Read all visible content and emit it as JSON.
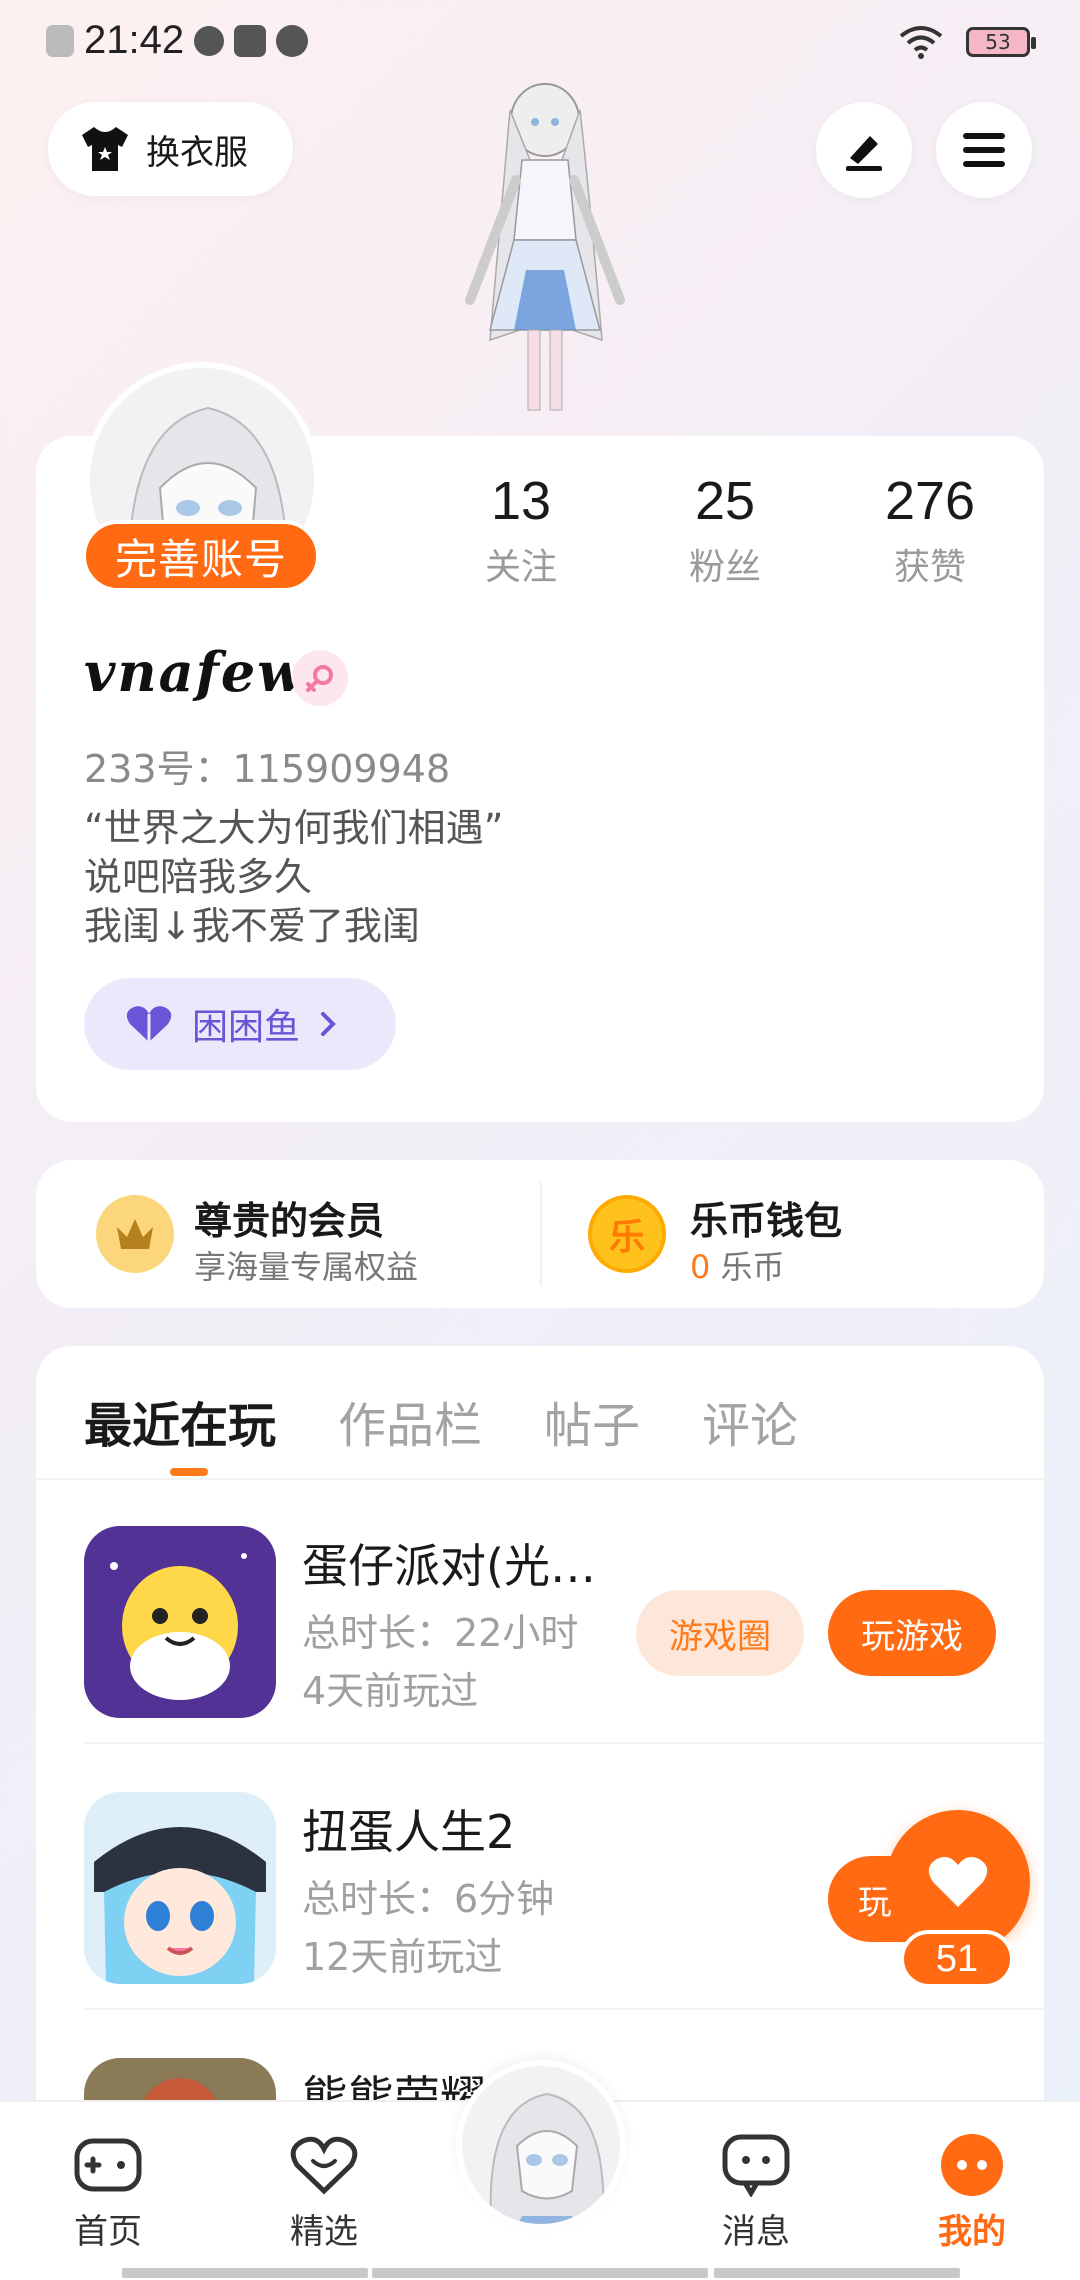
{
  "status_bar": {
    "time": "21:42",
    "battery": "53"
  },
  "header": {
    "outfit_label": "换衣服"
  },
  "profile": {
    "complete_badge": "完善账号",
    "stats": [
      {
        "num": "13",
        "label": "关注"
      },
      {
        "num": "25",
        "label": "粉丝"
      },
      {
        "num": "276",
        "label": "获赞"
      }
    ],
    "username": "vnafew",
    "uid": "233号：115909948",
    "bio": [
      "“世界之大为何我们相遇”",
      "说吧陪我多久",
      "我闺↓我不爱了我闺"
    ],
    "fish_label": "困困鱼"
  },
  "wallet": {
    "vip_title": "尊贵的会员",
    "vip_sub": "享海量专属权益",
    "coin_glyph": "乐",
    "coin_title": "乐币钱包",
    "coin_amount": "0",
    "coin_unit": "乐币"
  },
  "tabs": [
    "最近在玩",
    "作品栏",
    "帖子",
    "评论"
  ],
  "games": [
    {
      "name": "蛋仔派对(光…",
      "duration": "总时长：22小时",
      "last_played": "4天前玩过",
      "circle_label": "游戏圈",
      "play_label": "玩游戏"
    },
    {
      "name": "扭蛋人生2",
      "duration": "总时长：6分钟",
      "last_played": "12天前玩过",
      "play_label": "玩"
    },
    {
      "name": "熊熊荣耀"
    }
  ],
  "float_like": {
    "count": "51"
  },
  "bottom_nav": [
    {
      "label": "首页",
      "icon": "gamepad-icon"
    },
    {
      "label": "精选",
      "icon": "heart-chat-icon"
    },
    {
      "label": "消息",
      "icon": "message-icon"
    },
    {
      "label": "我的",
      "icon": "profile-dots-icon"
    }
  ],
  "colors": {
    "accent": "#ff6a13",
    "purple": "#6b54d6"
  }
}
